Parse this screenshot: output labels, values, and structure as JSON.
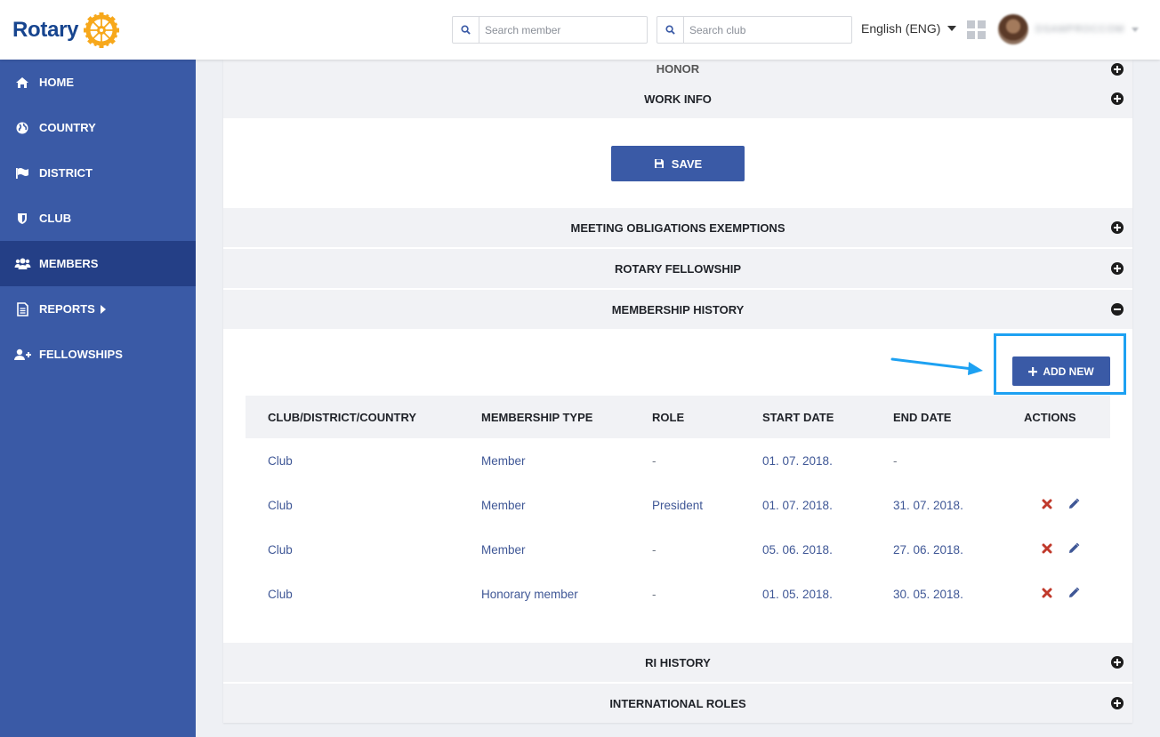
{
  "header": {
    "logo_text": "Rotary",
    "search_member_placeholder": "Search member",
    "search_club_placeholder": "Search club",
    "language": "English (ENG)",
    "user_name": "DSAMPROCCOM"
  },
  "sidebar": {
    "items": [
      {
        "label": "HOME",
        "icon": "home-icon"
      },
      {
        "label": "COUNTRY",
        "icon": "globe-icon"
      },
      {
        "label": "DISTRICT",
        "icon": "flag-icon"
      },
      {
        "label": "CLUB",
        "icon": "shield-icon"
      },
      {
        "label": "MEMBERS",
        "icon": "users-icon",
        "active": true
      },
      {
        "label": "REPORTS",
        "icon": "document-icon",
        "has_submenu": true
      },
      {
        "label": "FELLOWSHIPS",
        "icon": "user-plus-icon"
      }
    ]
  },
  "sections": {
    "honor": "HONOR",
    "work_info": "WORK INFO",
    "save_label": "SAVE",
    "meeting_obligations": "MEETING OBLIGATIONS EXEMPTIONS",
    "rotary_fellowship": "ROTARY FELLOWSHIP",
    "membership_history": "MEMBERSHIP HISTORY",
    "ri_history": "RI HISTORY",
    "international_roles": "INTERNATIONAL ROLES"
  },
  "membership_history": {
    "add_new_label": "ADD NEW",
    "columns": [
      "CLUB/DISTRICT/COUNTRY",
      "MEMBERSHIP TYPE",
      "ROLE",
      "START DATE",
      "END DATE",
      "ACTIONS"
    ],
    "rows": [
      {
        "org": "Club",
        "type": "Member",
        "role": "-",
        "start": "01. 07. 2018.",
        "end": "-",
        "actions": false
      },
      {
        "org": "Club",
        "type": "Member",
        "role": "President",
        "start": "01. 07. 2018.",
        "end": "31. 07. 2018.",
        "actions": true
      },
      {
        "org": "Club",
        "type": "Member",
        "role": "-",
        "start": "05. 06. 2018.",
        "end": "27. 06. 2018.",
        "actions": true
      },
      {
        "org": "Club",
        "type": "Honorary member",
        "role": "-",
        "start": "01. 05. 2018.",
        "end": "30. 05. 2018.",
        "actions": true
      }
    ]
  },
  "colors": {
    "primary": "#3a5aa6",
    "sidebar_active": "#243f86",
    "highlight": "#1da1f2",
    "delete": "#c0392b",
    "link": "#3f5796"
  }
}
